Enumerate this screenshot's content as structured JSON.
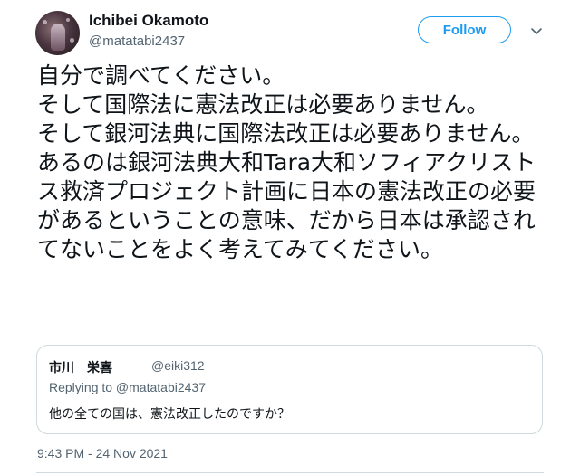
{
  "author": {
    "name": "Ichibei Okamoto",
    "handle": "@matatabi2437",
    "avatar_icon": "user-avatar"
  },
  "actions": {
    "follow_label": "Follow",
    "menu_icon": "chevron-down-icon"
  },
  "tweet": {
    "text": "自分で調べてください。\nそして国際法に憲法改正は必要ありません。\nそして銀河法典に国際法改正は必要ありません。\nあるのは銀河法典大和Tara大和ソフィアクリストス救済プロジェクト計画に日本の憲法改正の必要があるということの意味、だから日本は承認されてないことをよく考えてみてください。",
    "timestamp": "9:43 PM - 24 Nov 2021"
  },
  "quoted": {
    "name": "市川　栄喜",
    "handle": "@eiki312",
    "replying_to": "Replying to @matatabi2437",
    "text": "他の全ての国は、憲法改正したのですか？"
  },
  "colors": {
    "accent": "#1d9bf0",
    "text": "#0f1419",
    "secondary": "#536471",
    "border": "#cfd9de"
  }
}
